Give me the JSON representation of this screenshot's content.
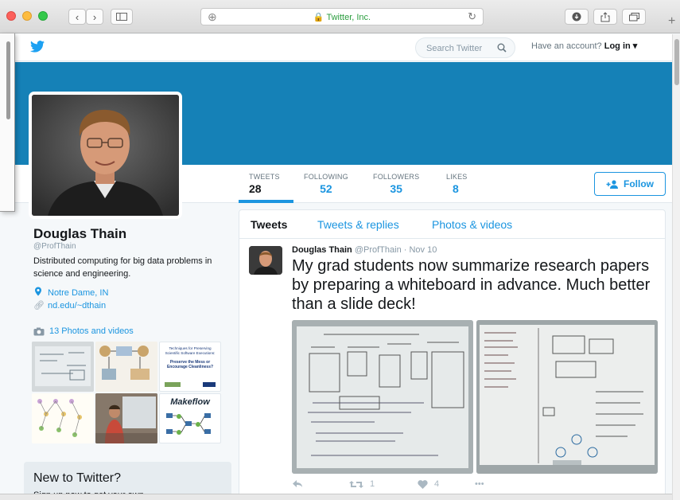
{
  "browser": {
    "address_text": "🔒 Twitter, Inc."
  },
  "topbar": {
    "search_placeholder": "Search Twitter",
    "account_prompt": "Have an account?",
    "login_label": "Log in ▾"
  },
  "profile_nav": {
    "stats": [
      {
        "label": "TWEETS",
        "value": "28"
      },
      {
        "label": "FOLLOWING",
        "value": "52"
      },
      {
        "label": "FOLLOWERS",
        "value": "35"
      },
      {
        "label": "LIKES",
        "value": "8"
      }
    ],
    "follow_label": "Follow"
  },
  "profile": {
    "name": "Douglas Thain",
    "handle": "@ProfThain",
    "bio": "Distributed computing for big data problems in science and engineering.",
    "location": "Notre Dame, IN",
    "website": "nd.edu/~dthain",
    "photos_label": "13 Photos and videos",
    "thumb_titles": [
      "Techniques for Preserving Scientific Software Executions:",
      "Preserve the Mess or Encourage Cleanliness?",
      "Makeflow"
    ]
  },
  "new_to_twitter": {
    "title": "New to Twitter?",
    "subtitle": "Sign up now to get your own"
  },
  "timeline": {
    "tabs": [
      "Tweets",
      "Tweets & replies",
      "Photos & videos"
    ],
    "tweet": {
      "author": "Douglas Thain",
      "handle": "@ProfThain",
      "date": "· Nov 10",
      "text": "My grad students now summarize research papers by preparing a whiteboard in advance.  Much better than a slide deck!",
      "retweets": "1",
      "likes": "4"
    }
  }
}
